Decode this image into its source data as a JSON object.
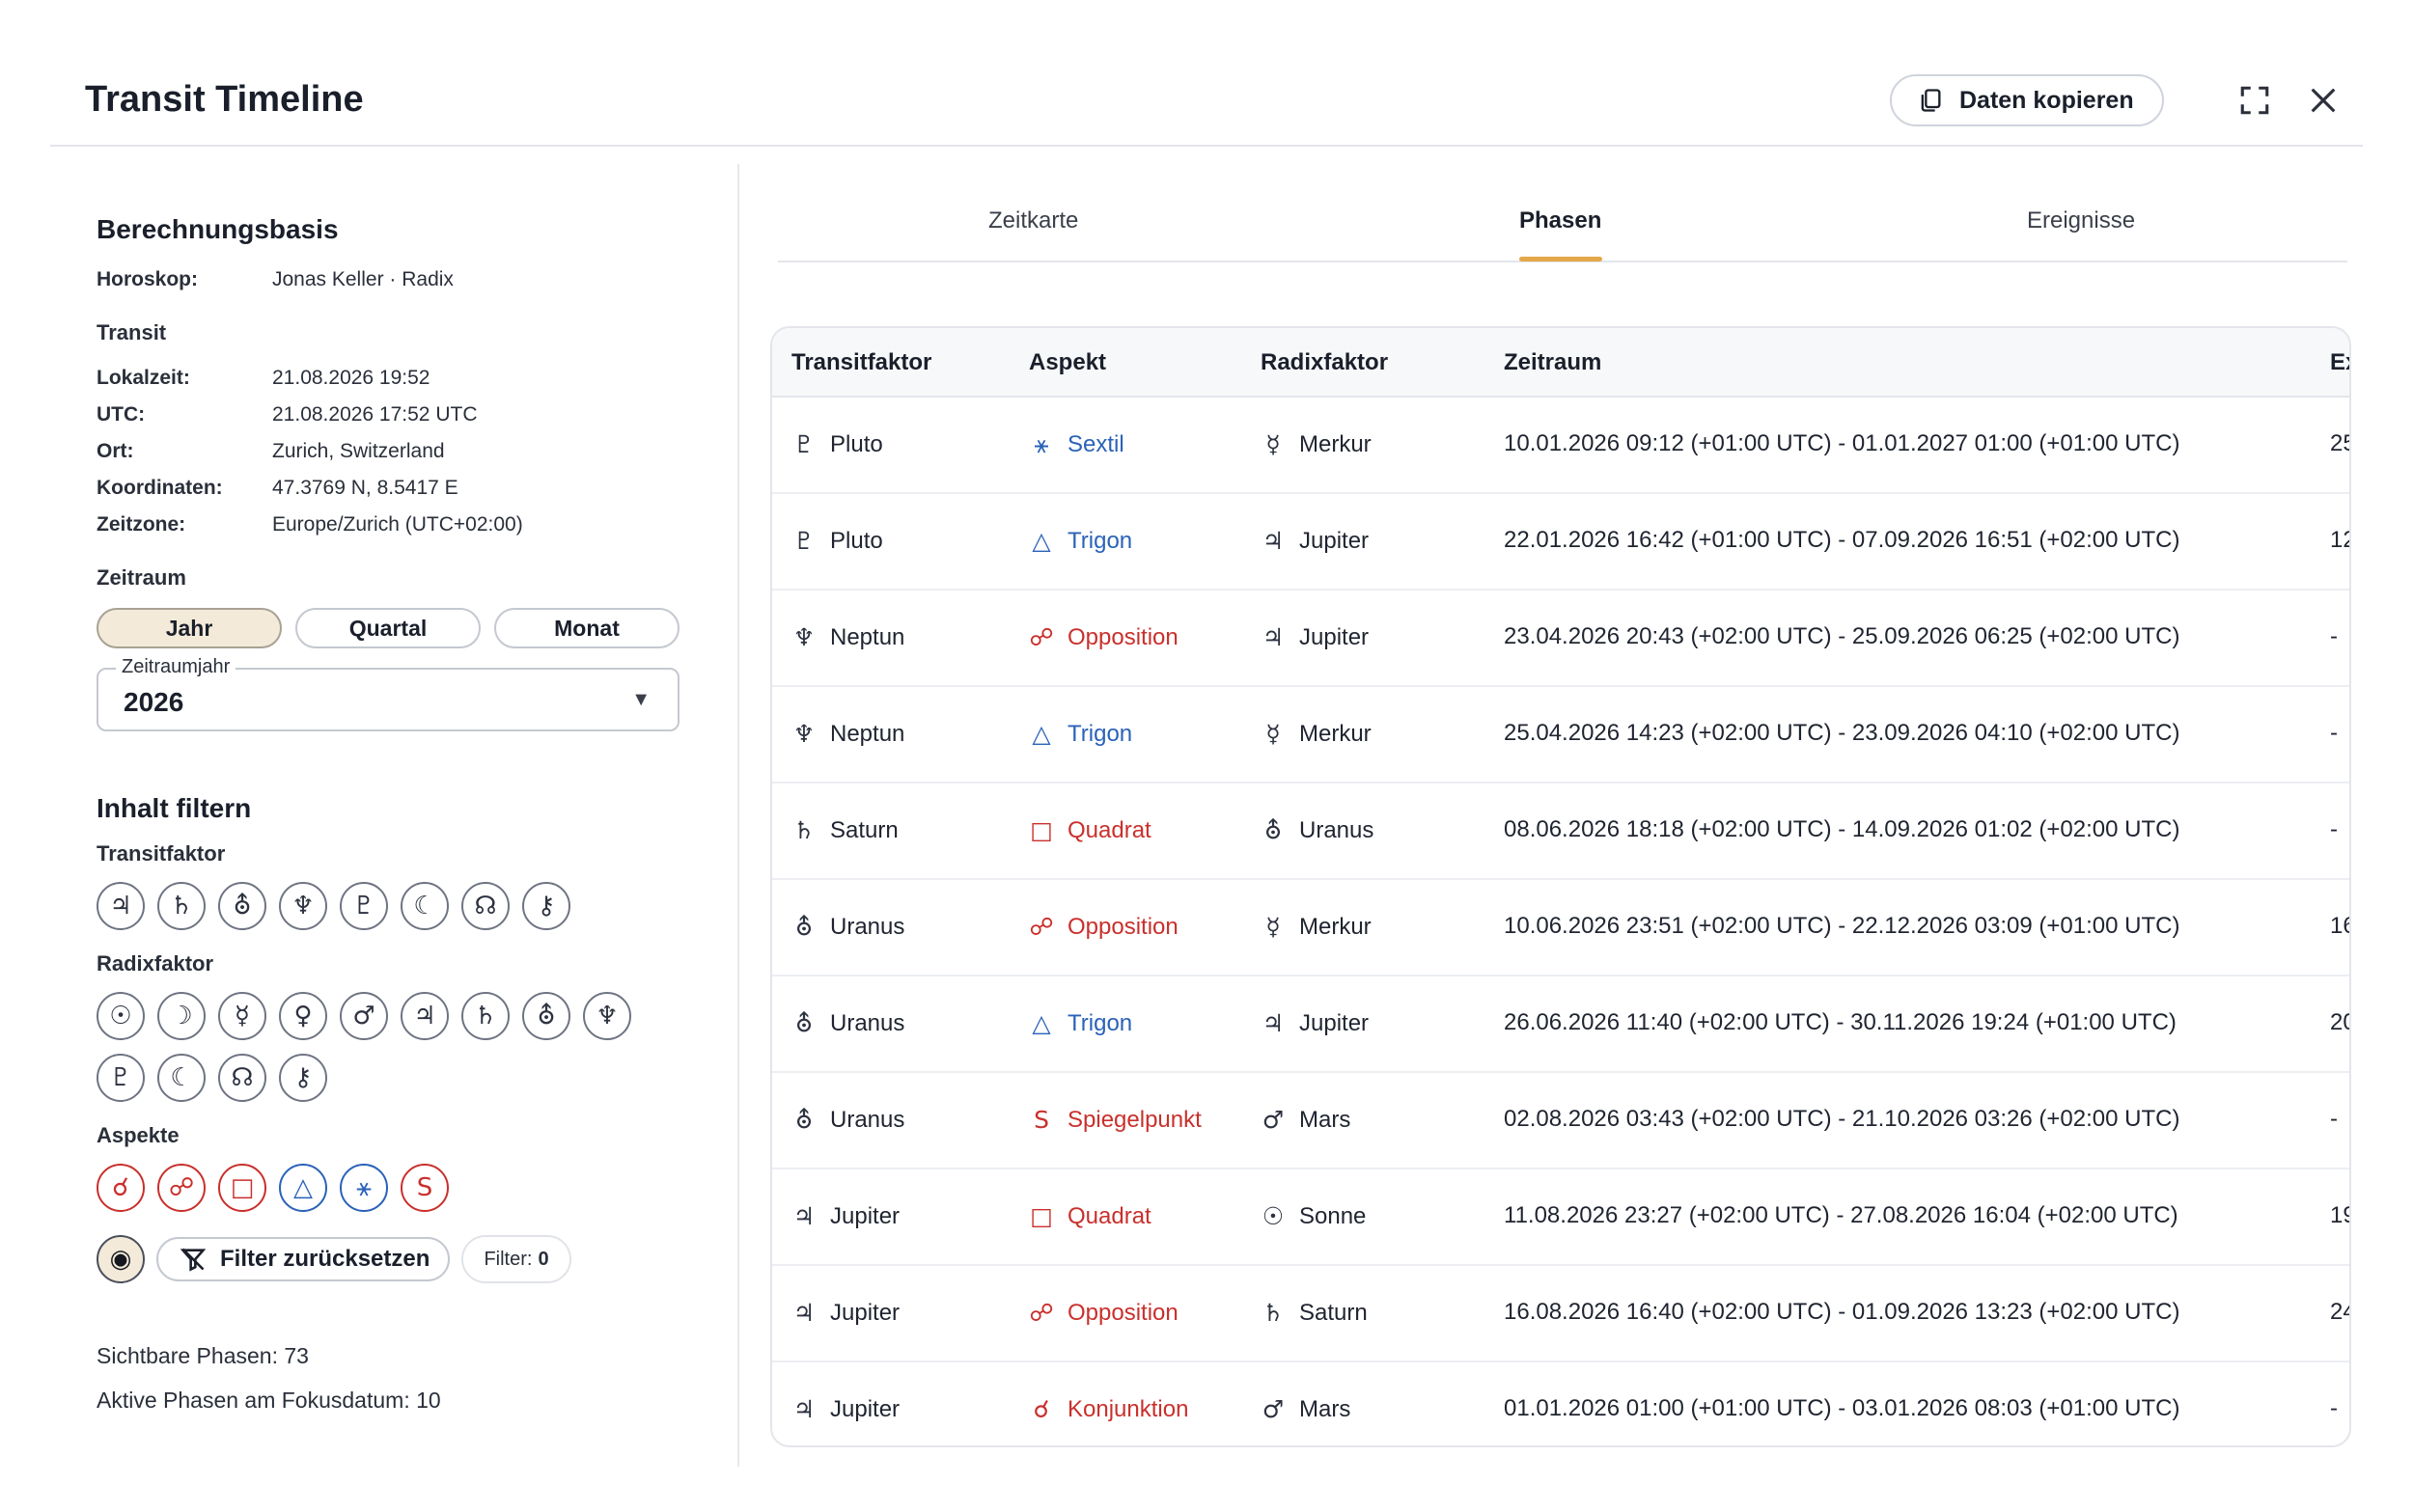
{
  "header": {
    "title": "Transit Timeline",
    "copy_label": "Daten kopieren"
  },
  "basis": {
    "title": "Berechnungsbasis",
    "horoskop_key": "Horoskop:",
    "horoskop_val": "Jonas Keller · Radix",
    "transit_title": "Transit",
    "rows": [
      {
        "key": "Lokalzeit:",
        "val": "21.08.2026 19:52"
      },
      {
        "key": "UTC:",
        "val": "21.08.2026 17:52 UTC"
      },
      {
        "key": "Ort:",
        "val": "Zurich, Switzerland"
      },
      {
        "key": "Koordinaten:",
        "val": "47.3769 N, 8.5417 E"
      },
      {
        "key": "Zeitzone:",
        "val": "Europe/Zurich (UTC+02:00)"
      }
    ]
  },
  "zeitraum": {
    "title": "Zeitraum",
    "options": [
      "Jahr",
      "Quartal",
      "Monat"
    ],
    "selected": "Jahr",
    "select_label": "Zeitraumjahr",
    "select_value": "2026"
  },
  "filter": {
    "title": "Inhalt filtern",
    "transit_title": "Transitfaktor",
    "transit_chips": [
      "♃",
      "♄",
      "⛢",
      "♆",
      "♇",
      "☾",
      "☊",
      "⚷"
    ],
    "radix_title": "Radixfaktor",
    "radix_chips": [
      "☉",
      "☽",
      "☿",
      "♀",
      "♂",
      "♃",
      "♄",
      "⛢",
      "♆",
      "♇",
      "☾",
      "☊",
      "⚷"
    ],
    "aspekte_title": "Aspekte",
    "aspekt_chips": [
      "☌",
      "☍",
      "□",
      "△",
      "⚹",
      "S"
    ],
    "reset_label": "Filter zurücksetzen",
    "count_label": "Filter:",
    "count_value": "0"
  },
  "stats": {
    "sichtbar": "Sichtbare Phasen: 73",
    "aktiv": "Aktive Phasen am Fokusdatum: 10"
  },
  "tabs": [
    "Zeitkarte",
    "Phasen",
    "Ereignisse"
  ],
  "active_tab": "Phasen",
  "table": {
    "headers": [
      "Transitfaktor",
      "Aspekt",
      "Radixfaktor",
      "Zeitraum",
      "Ex"
    ],
    "rows": [
      {
        "t_icon": "♇",
        "t": "Pluto",
        "a_icon": "⚹",
        "a": "Sextil",
        "a_color": "blue",
        "r_icon": "☿",
        "r": "Merkur",
        "z": "10.01.2026 09:12 (+01:00 UTC) - 01.01.2027 01:00 (+01:00 UTC)",
        "ex": "25"
      },
      {
        "t_icon": "♇",
        "t": "Pluto",
        "a_icon": "△",
        "a": "Trigon",
        "a_color": "blue",
        "r_icon": "♃",
        "r": "Jupiter",
        "z": "22.01.2026 16:42 (+01:00 UTC) - 07.09.2026 16:51 (+02:00 UTC)",
        "ex": "12"
      },
      {
        "t_icon": "♆",
        "t": "Neptun",
        "a_icon": "☍",
        "a": "Opposition",
        "a_color": "red",
        "r_icon": "♃",
        "r": "Jupiter",
        "z": "23.04.2026 20:43 (+02:00 UTC) - 25.09.2026 06:25 (+02:00 UTC)",
        "ex": "-"
      },
      {
        "t_icon": "♆",
        "t": "Neptun",
        "a_icon": "△",
        "a": "Trigon",
        "a_color": "blue",
        "r_icon": "☿",
        "r": "Merkur",
        "z": "25.04.2026 14:23 (+02:00 UTC) - 23.09.2026 04:10 (+02:00 UTC)",
        "ex": "-"
      },
      {
        "t_icon": "♄",
        "t": "Saturn",
        "a_icon": "□",
        "a": "Quadrat",
        "a_color": "red",
        "r_icon": "⛢",
        "r": "Uranus",
        "z": "08.06.2026 18:18 (+02:00 UTC) - 14.09.2026 01:02 (+02:00 UTC)",
        "ex": "-"
      },
      {
        "t_icon": "⛢",
        "t": "Uranus",
        "a_icon": "☍",
        "a": "Opposition",
        "a_color": "red",
        "r_icon": "☿",
        "r": "Merkur",
        "z": "10.06.2026 23:51 (+02:00 UTC) - 22.12.2026 03:09 (+01:00 UTC)",
        "ex": "16"
      },
      {
        "t_icon": "⛢",
        "t": "Uranus",
        "a_icon": "△",
        "a": "Trigon",
        "a_color": "blue",
        "r_icon": "♃",
        "r": "Jupiter",
        "z": "26.06.2026 11:40 (+02:00 UTC) - 30.11.2026 19:24 (+01:00 UTC)",
        "ex": "20"
      },
      {
        "t_icon": "⛢",
        "t": "Uranus",
        "a_icon": "S",
        "a": "Spiegelpunkt",
        "a_color": "red",
        "r_icon": "♂",
        "r": "Mars",
        "z": "02.08.2026 03:43 (+02:00 UTC) - 21.10.2026 03:26 (+02:00 UTC)",
        "ex": "-"
      },
      {
        "t_icon": "♃",
        "t": "Jupiter",
        "a_icon": "□",
        "a": "Quadrat",
        "a_color": "red",
        "r_icon": "☉",
        "r": "Sonne",
        "z": "11.08.2026 23:27 (+02:00 UTC) - 27.08.2026 16:04 (+02:00 UTC)",
        "ex": "19"
      },
      {
        "t_icon": "♃",
        "t": "Jupiter",
        "a_icon": "☍",
        "a": "Opposition",
        "a_color": "red",
        "r_icon": "♄",
        "r": "Saturn",
        "z": "16.08.2026 16:40 (+02:00 UTC) - 01.09.2026 13:23 (+02:00 UTC)",
        "ex": "24"
      },
      {
        "t_icon": "♃",
        "t": "Jupiter",
        "a_icon": "☌",
        "a": "Konjunktion",
        "a_color": "red",
        "r_icon": "♂",
        "r": "Mars",
        "z": "01.01.2026 01:00 (+01:00 UTC) - 03.01.2026 08:03 (+01:00 UTC)",
        "ex": "-"
      }
    ]
  },
  "icons": {
    "copy": "copy-icon",
    "expand": "expand-icon",
    "close": "close-icon",
    "reset": "filter-off-icon",
    "caret": "caret-down-icon"
  },
  "colors": {
    "accent": "#e4a74a",
    "red": "#c9302c",
    "blue": "#2a62b8",
    "selected_bg": "#f3ead9"
  }
}
